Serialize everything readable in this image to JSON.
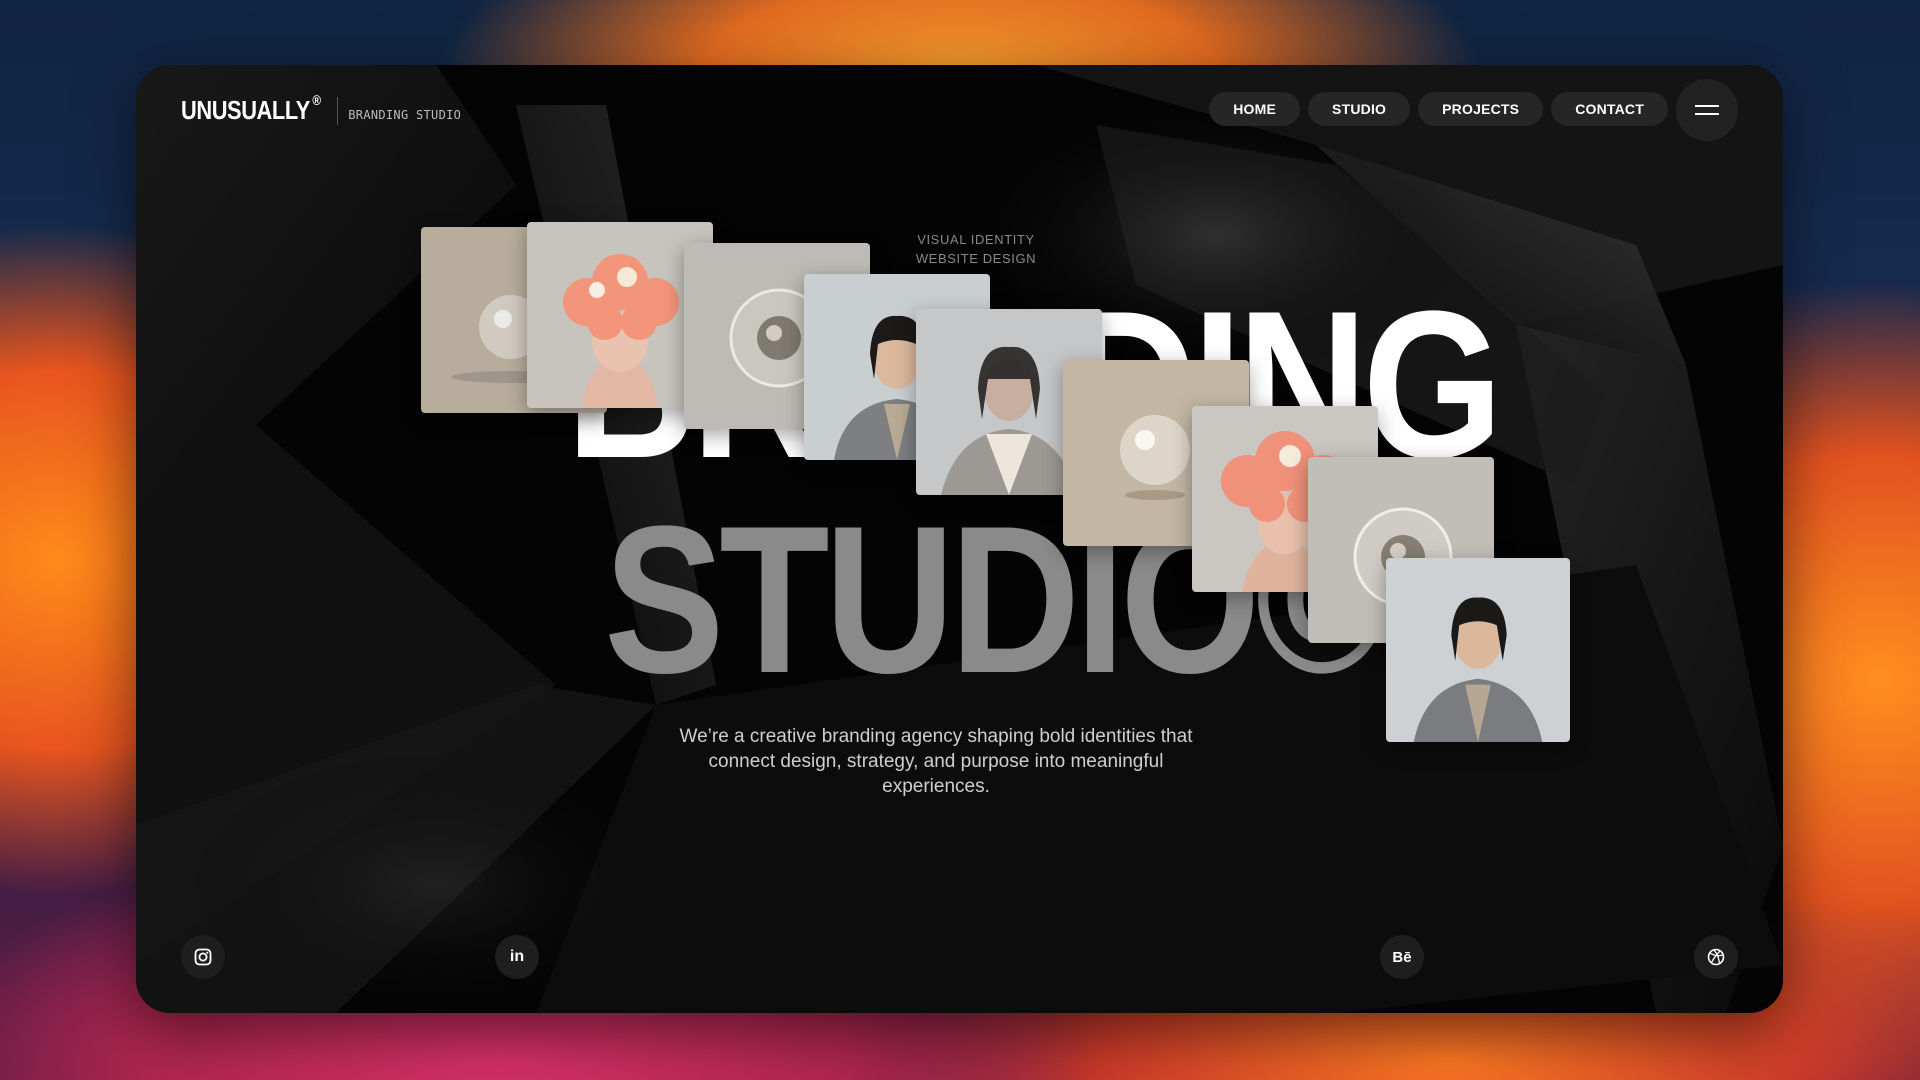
{
  "brand": {
    "logo": "UNUSUALLY",
    "logo_mark": "®",
    "subtitle": "BRANDING STUDIO"
  },
  "nav": {
    "items": [
      "HOME",
      "STUDIO",
      "PROJECTS",
      "CONTACT"
    ],
    "menu_icon": "hamburger-icon"
  },
  "hero": {
    "tags": [
      "VISUAL IDENTITY",
      "WEBSITE DESIGN"
    ],
    "title_line_1": "BRANDING",
    "title_line_2": "STUDIO©",
    "tagline": "We’re a creative branding agency shaping bold identities that connect design, strategy, and purpose into meaningful experiences."
  },
  "social": [
    {
      "name": "instagram-icon",
      "glyph": ""
    },
    {
      "name": "linkedin-icon",
      "glyph": "in"
    },
    {
      "name": "behance-icon",
      "glyph": "Bē"
    },
    {
      "name": "dribbble-icon",
      "glyph": ""
    }
  ],
  "colors": {
    "window_bg": "#030303",
    "nav_pill": "#262626",
    "title_gray": "#8a8a8a"
  }
}
